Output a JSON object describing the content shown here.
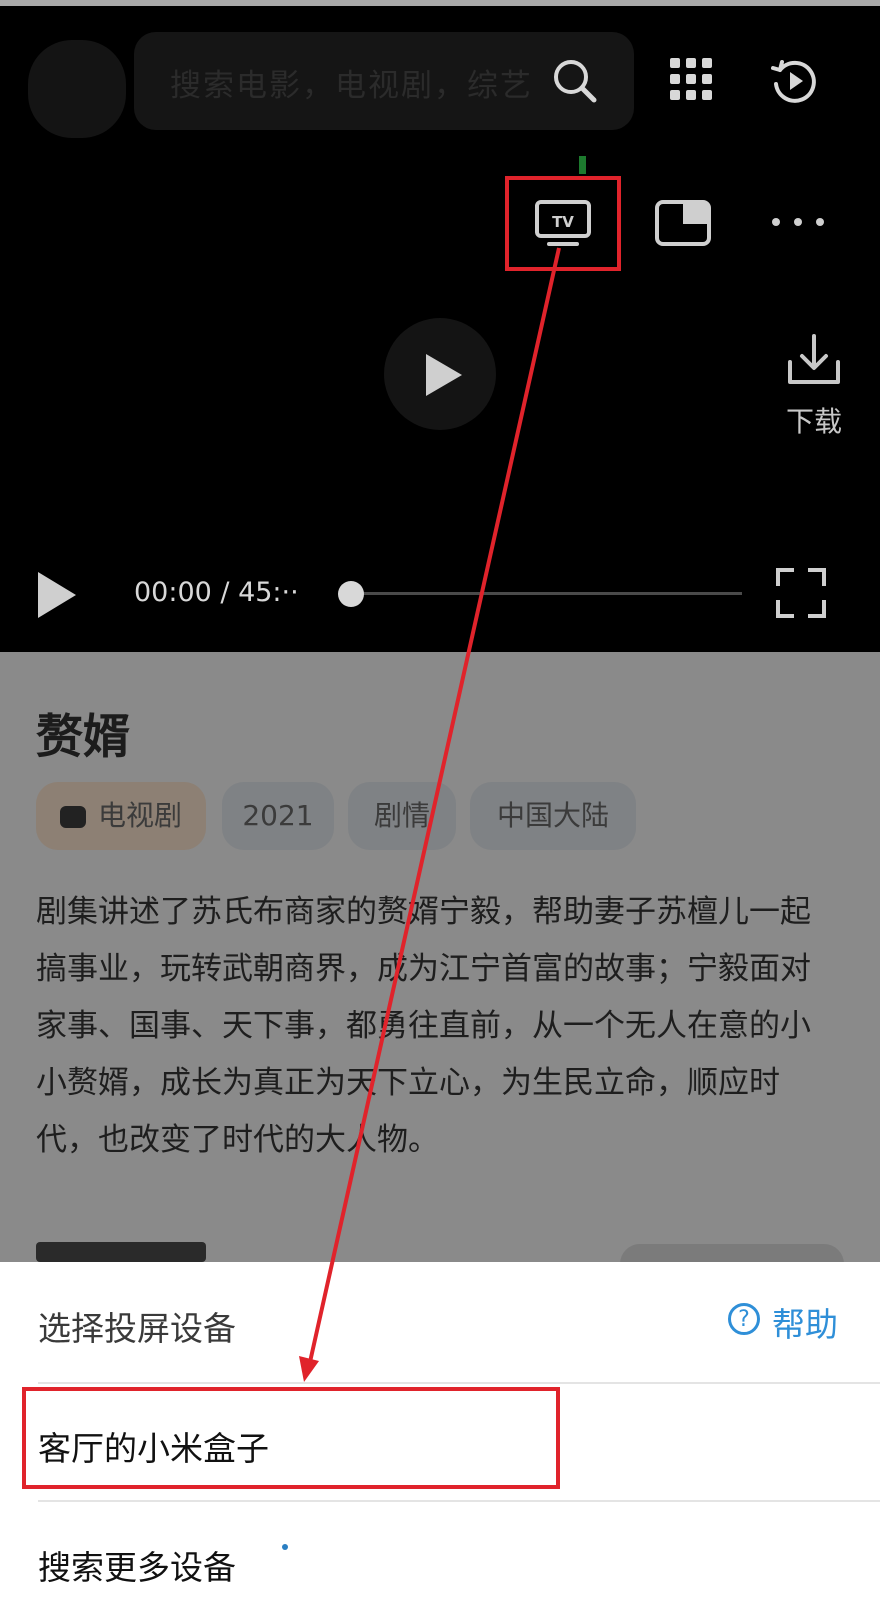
{
  "header": {
    "search_placeholder": "搜索电影，电视剧，综艺",
    "icons": [
      "search-icon",
      "apps-grid-icon",
      "history-play-icon"
    ]
  },
  "player": {
    "controls": [
      "tv-cast-icon",
      "pip-icon",
      "more-icon"
    ],
    "tv_label": "TV",
    "download_label": "下载",
    "time_display": "00:00 / 45:··",
    "progress": 0
  },
  "show": {
    "title": "赘婿",
    "tags": [
      "电视剧",
      "2021",
      "剧情",
      "中国大陆"
    ],
    "description": "剧集讲述了苏氏布商家的赘婿宁毅，帮助妻子苏檀儿一起搞事业，玩转武朝商界，成为江宁首富的故事；宁毅面对家事、国事、天下事，都勇往直前，从一个无人在意的小小赘婿，成长为真正为天下立心，为生民立命，顺应时代，也改变了时代的大人物。"
  },
  "cast_sheet": {
    "title": "选择投屏设备",
    "help_label": "帮助",
    "help_icon_glyph": "?",
    "devices": [
      "客厅的小米盒子"
    ],
    "search_more_label": "搜索更多设备"
  },
  "annotation": {
    "highlight_color": "#e0232b"
  }
}
